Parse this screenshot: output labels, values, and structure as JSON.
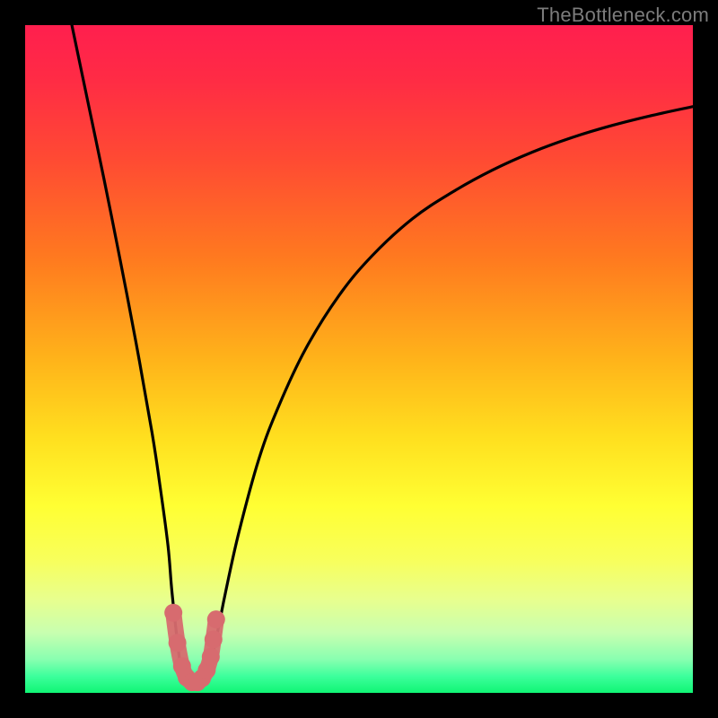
{
  "watermark": {
    "text": "TheBottleneck.com"
  },
  "colors": {
    "frame": "#000000",
    "curve": "#000000",
    "marker": "#d76b6f",
    "gradient_stops": [
      {
        "offset": 0.0,
        "color": "#ff1f4e"
      },
      {
        "offset": 0.08,
        "color": "#ff2b45"
      },
      {
        "offset": 0.2,
        "color": "#ff4a33"
      },
      {
        "offset": 0.35,
        "color": "#ff7a1f"
      },
      {
        "offset": 0.5,
        "color": "#ffb31a"
      },
      {
        "offset": 0.62,
        "color": "#ffe01f"
      },
      {
        "offset": 0.72,
        "color": "#ffff33"
      },
      {
        "offset": 0.8,
        "color": "#f8ff5b"
      },
      {
        "offset": 0.86,
        "color": "#e8ff8e"
      },
      {
        "offset": 0.91,
        "color": "#c8ffb0"
      },
      {
        "offset": 0.95,
        "color": "#88ffb0"
      },
      {
        "offset": 0.975,
        "color": "#3dff9c"
      },
      {
        "offset": 1.0,
        "color": "#10f574"
      }
    ]
  },
  "chart_data": {
    "type": "line",
    "title": "",
    "xlabel": "",
    "ylabel": "",
    "xlim": [
      0,
      100
    ],
    "ylim": [
      0,
      100
    ],
    "series": [
      {
        "name": "left-branch",
        "x": [
          7.0,
          9.4,
          11.8,
          14.2,
          16.6,
          19.0,
          20.2,
          21.4,
          22.0,
          23.0,
          23.5
        ],
        "y": [
          100,
          88.5,
          77.0,
          65.0,
          52.5,
          39.0,
          31.0,
          22.0,
          15.0,
          6.0,
          2.5
        ]
      },
      {
        "name": "valley-bottom",
        "x": [
          23.5,
          24.2,
          25.0,
          25.8,
          26.5,
          27.0
        ],
        "y": [
          2.5,
          1.5,
          1.2,
          1.3,
          1.6,
          2.2
        ]
      },
      {
        "name": "right-branch",
        "x": [
          27.0,
          28.0,
          29.0,
          30.0,
          32.0,
          35.0,
          38.0,
          42.0,
          47.0,
          52.0,
          58.0,
          64.0,
          70.0,
          76.0,
          82.0,
          88.0,
          94.0,
          100.0
        ],
        "y": [
          2.2,
          5.5,
          10.0,
          15.0,
          24.0,
          35.0,
          43.0,
          51.5,
          59.5,
          65.5,
          71.0,
          75.0,
          78.3,
          81.0,
          83.2,
          85.0,
          86.5,
          87.8
        ]
      }
    ],
    "markers": {
      "name": "highlighted-points",
      "x": [
        22.2,
        22.8,
        23.5,
        24.2,
        25.0,
        25.8,
        26.5,
        27.2,
        27.8,
        28.2,
        28.6
      ],
      "y": [
        12.0,
        7.5,
        4.0,
        2.3,
        1.6,
        1.6,
        2.2,
        3.4,
        5.4,
        8.0,
        11.0
      ]
    }
  }
}
